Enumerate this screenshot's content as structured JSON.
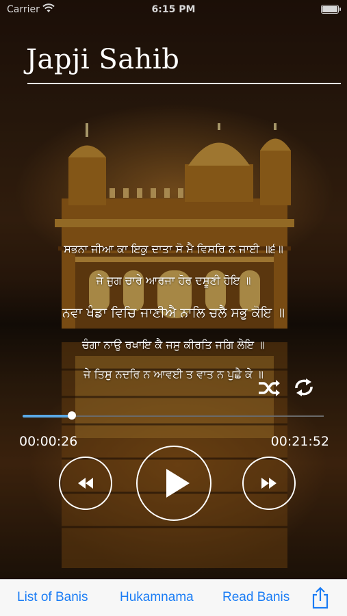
{
  "status_bar": {
    "carrier": "Carrier",
    "time": "6:15 PM"
  },
  "title": "Japji Sahib",
  "lyrics": [
    "ਸਭਨਾ ਜੀਆ ਕਾ ਇਕੁ ਦਾਤਾ ਸੋ ਮੈ ਵਿਸਰਿ ਨ ਜਾਈ ॥੬॥",
    "ਜੇ ਜੁਗ ਚਾਰੇ ਆਰਜਾ ਹੋਰ ਦਸੂਣੀ ਹੋਇ ॥",
    "ਨਵਾ ਖੰਡਾ ਵਿਚਿ ਜਾਣੀਐ ਨਾਲਿ ਚਲੈ ਸਭੁ ਕੋਇ ॥",
    "ਚੰਗਾ ਨਾਉ ਰਖਾਇ ਕੈ ਜਸੁ ਕੀਰਤਿ ਜਗਿ ਲੇਇ ॥",
    "ਜੇ ਤਿਸੁ ਨਦਰਿ ਨ ਆਵਈ ਤ ਵਾਤ ਨ ਪੁਛੈ ਕੇ ॥"
  ],
  "current_lyric_index": 2,
  "player": {
    "elapsed": "00:00:26",
    "total": "00:21:52",
    "progress_fraction": 0.164,
    "accent_color": "#5aa9e6"
  },
  "icons": {
    "shuffle": "shuffle-icon",
    "repeat": "repeat-icon",
    "rewind": "rewind-icon",
    "play": "play-icon",
    "fast_forward": "fast-forward-icon",
    "share": "share-icon"
  },
  "tabs": [
    {
      "label": "List of Banis"
    },
    {
      "label": "Hukamnama"
    },
    {
      "label": "Read Banis"
    }
  ],
  "tab_color": "#1a7cf5"
}
